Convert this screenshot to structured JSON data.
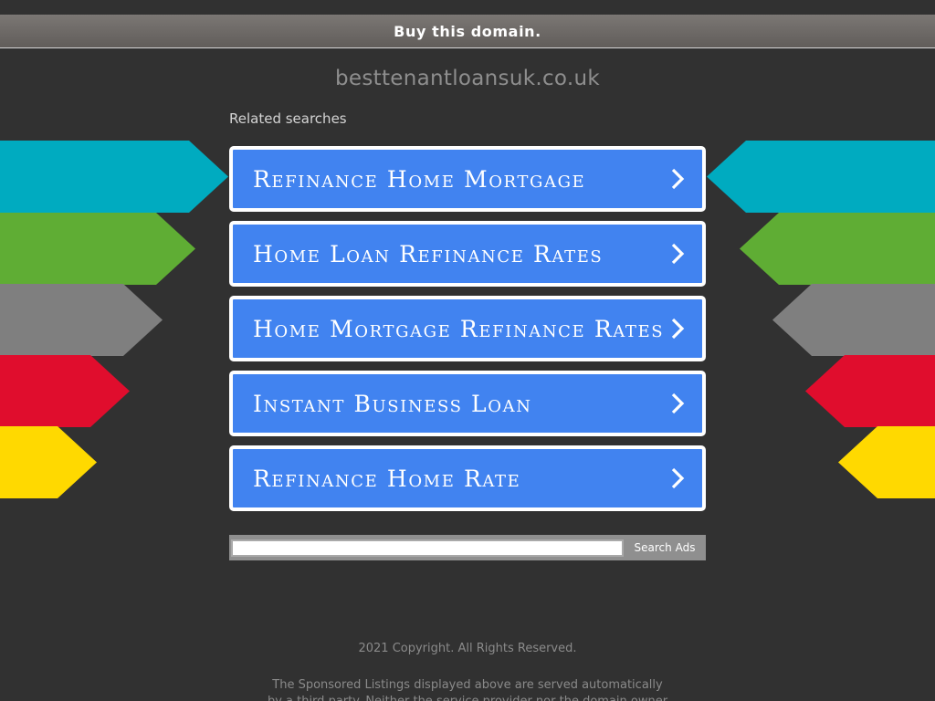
{
  "banner": {
    "text": "Buy this domain."
  },
  "domain": {
    "name": "besttenantloansuk.co.uk"
  },
  "related": {
    "label": "Related searches",
    "items": [
      {
        "label": "Refinance Home Mortgage"
      },
      {
        "label": "Home Loan Refinance Rates"
      },
      {
        "label": "Home Mortgage Refinance Rates"
      },
      {
        "label": "Instant Business Loan"
      },
      {
        "label": "Refinance Home Rate"
      }
    ]
  },
  "search": {
    "value": "",
    "button_label": "Search Ads"
  },
  "footer": {
    "copyright": "2021 Copyright. All Rights Reserved.",
    "disclaimer_line1": "The Sponsored Listings displayed above are served automatically",
    "disclaimer_line2": "by a third party. Neither the service provider nor the domain owner"
  },
  "colors": {
    "background": "#313131",
    "button_blue": "#4183f0",
    "arrow_teal": "#00abc0",
    "arrow_green": "#5fad34",
    "arrow_gray": "#7f7f7f",
    "arrow_red": "#e00d2d",
    "arrow_yellow": "#ffd900"
  }
}
